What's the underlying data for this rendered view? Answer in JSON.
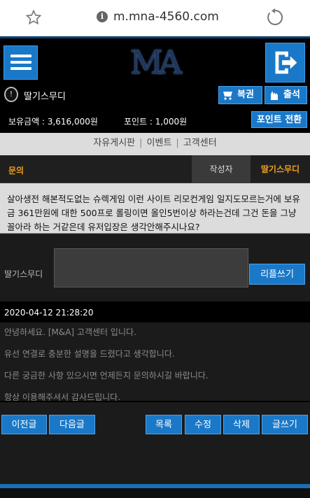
{
  "browser": {
    "url": "m.mna-4560.com"
  },
  "header": {
    "logo_text": "MA"
  },
  "user": {
    "name": "딸기스무디",
    "btn_bokgwon": "복권",
    "btn_checkin": "출석",
    "balance": "보유금액 : 3,616,000원",
    "points": "포인트 : 1,000원",
    "convert_label": "포인트 전환"
  },
  "boardnav": {
    "items": [
      "자유게시판",
      "이벤트",
      "고객센터"
    ],
    "separator": "|"
  },
  "post": {
    "category": "문의",
    "writer_label": "작성자",
    "writer_name": "딸기스무디",
    "body": "살아생전 해본적도없는 슈렉게임 이런 사이트 리모컨게임 일지도모르는거에 보유금 361만원에 대한 500프로 롤링이면 올인5번이상 하라는건데 그건 돈을 그냥 꼴아라 하는 거같은데 유저입장은 생각안해주시나요?"
  },
  "comment": {
    "name": "딸기스무디",
    "reply_label": "리플쓰기"
  },
  "answer": {
    "date": "2020-04-12 21:28:20",
    "lines": [
      "안녕하세요. [M&A] 고객센터 입니다.",
      "유선 연결로 충분한 설명을 드렸다고 생각합니다.",
      "다른 궁금한 사항 있으시면 언제든지 문의하시길 바랍니다.",
      "항상 이용해주셔서 감사드립니다."
    ]
  },
  "actions": {
    "prev": "이전글",
    "next": "다음글",
    "list": "목록",
    "edit": "수정",
    "delete": "삭제",
    "write": "글쓰기"
  },
  "colors": {
    "accent_blue": "#1a78c8",
    "highlight_orange": "#f0a020"
  }
}
